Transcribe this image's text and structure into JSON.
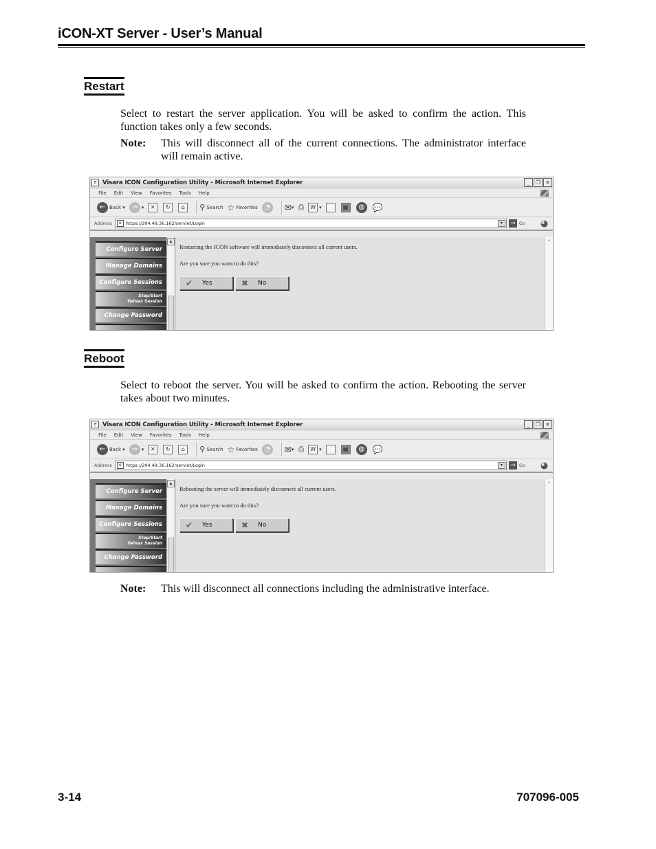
{
  "header": {
    "title": "iCON-XT Server - User’s Manual"
  },
  "sections": [
    {
      "heading": "Restart",
      "body": "Select to restart the server application. You will be asked to confirm the action. This function takes only a few seconds.",
      "note_label": "Note:",
      "note_text": "This will disconnect all of the current connections. The administrator interface will remain active.",
      "screenshot": {
        "window_title": "Visara ICON Configuration Utility - Microsoft Internet Explorer",
        "menu": [
          "File",
          "Edit",
          "View",
          "Favorites",
          "Tools",
          "Help"
        ],
        "toolbar": {
          "back": "Back",
          "search": "Search",
          "favorites": "Favorites"
        },
        "address_label": "Address",
        "address_value": "https://204.48.36.162/servlet/Login",
        "go_label": "Go",
        "nav_items": [
          "Configure Server",
          "Manage Domains",
          "Configure Sessions",
          "Stop/Start",
          "Twinax Session",
          "Change Password"
        ],
        "message": "Restarting the ICON software will immediately disconnect all current users.",
        "question": "Are you sure you want to do this?",
        "yes_label": "Yes",
        "no_label": "No"
      }
    },
    {
      "heading": "Reboot",
      "body": "Select to reboot the server. You will be asked to confirm the action. Rebooting the server takes about two minutes.",
      "screenshot": {
        "window_title": "Visara ICON Configuration Utility - Microsoft Internet Explorer",
        "menu": [
          "File",
          "Edit",
          "View",
          "Favorites",
          "Tools",
          "Help"
        ],
        "toolbar": {
          "back": "Back",
          "search": "Search",
          "favorites": "Favorites"
        },
        "address_label": "Address",
        "address_value": "https://204.48.36.162/servlet/Login",
        "go_label": "Go",
        "nav_items": [
          "Configure Server",
          "Manage Domains",
          "Configure Sessions",
          "Stop/Start",
          "Twinax Session",
          "Change Password"
        ],
        "message": "Rebooting the server will immediately disconnect all current users.",
        "question": "Are you sure you want to do this?",
        "yes_label": "Yes",
        "no_label": "No"
      },
      "note_label": "Note:",
      "note_text": "This will disconnect all connections including the administrative interface."
    }
  ],
  "footer": {
    "page_number": "3-14",
    "doc_number": "707096-005"
  }
}
